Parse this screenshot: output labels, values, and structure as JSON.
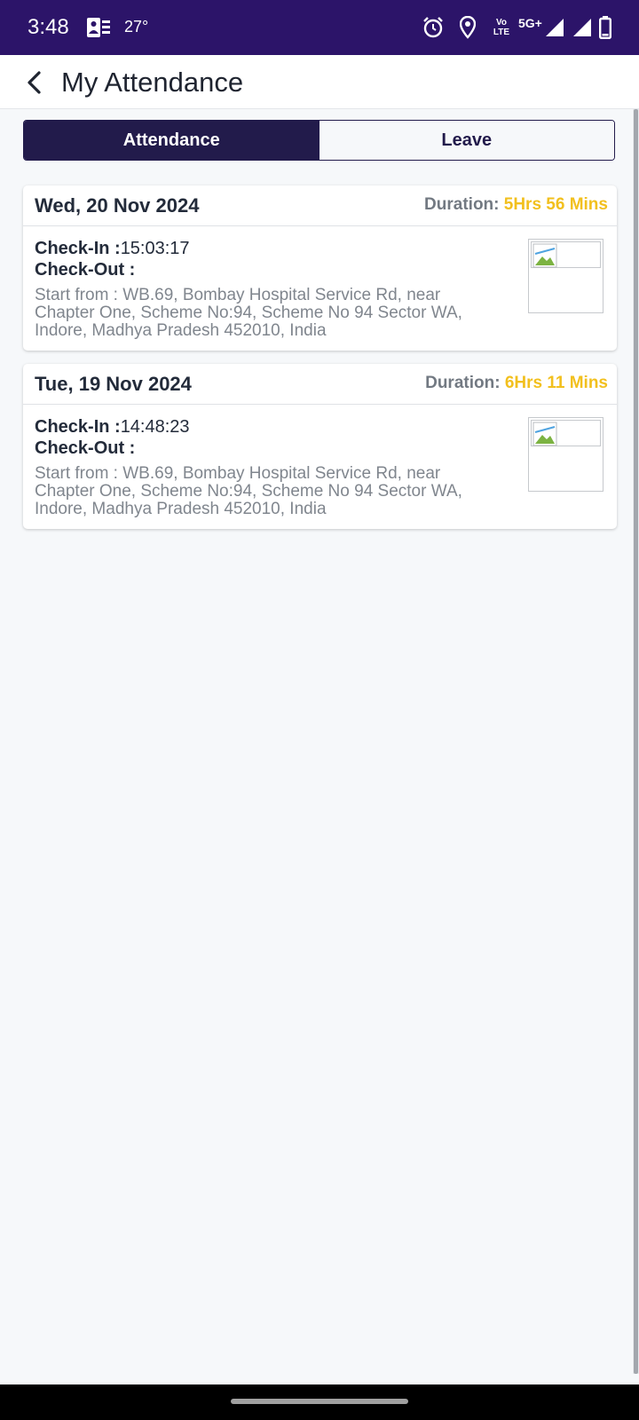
{
  "status_bar": {
    "time": "3:48",
    "temperature": "27°",
    "icons": [
      "people-icon",
      "alarm-icon",
      "location-icon",
      "volte-icon",
      "5g-icon",
      "signal-icon",
      "signal-icon",
      "battery-icon"
    ],
    "volte_label": "Vo LTE",
    "network_label": "5G+"
  },
  "header": {
    "title": "My Attendance"
  },
  "tabs": [
    {
      "label": "Attendance",
      "active": true
    },
    {
      "label": "Leave",
      "active": false
    }
  ],
  "records": [
    {
      "date": "Wed, 20 Nov 2024",
      "duration_label": "Duration:",
      "duration_value": "5Hrs 56 Mins",
      "check_in_label": "Check-In :",
      "check_in_value": "15:03:17",
      "check_out_label": "Check-Out :",
      "check_out_value": "",
      "address": "Start from : WB.69, Bombay Hospital Service Rd, near Chapter One, Scheme No:94, Scheme No 94 Sector WA, Indore, Madhya Pradesh 452010, India"
    },
    {
      "date": "Tue, 19 Nov 2024",
      "duration_label": "Duration:",
      "duration_value": "6Hrs 11 Mins",
      "check_in_label": "Check-In :",
      "check_in_value": "14:48:23",
      "check_out_label": "Check-Out :",
      "check_out_value": "",
      "address": "Start from : WB.69, Bombay Hospital Service Rd, near Chapter One, Scheme No:94, Scheme No 94 Sector WA, Indore, Madhya Pradesh 452010, India"
    }
  ],
  "colors": {
    "status_bar": "#2c1469",
    "tab_active": "#221b4b",
    "duration_accent": "#f2c01e",
    "duration_label": "#727982"
  }
}
